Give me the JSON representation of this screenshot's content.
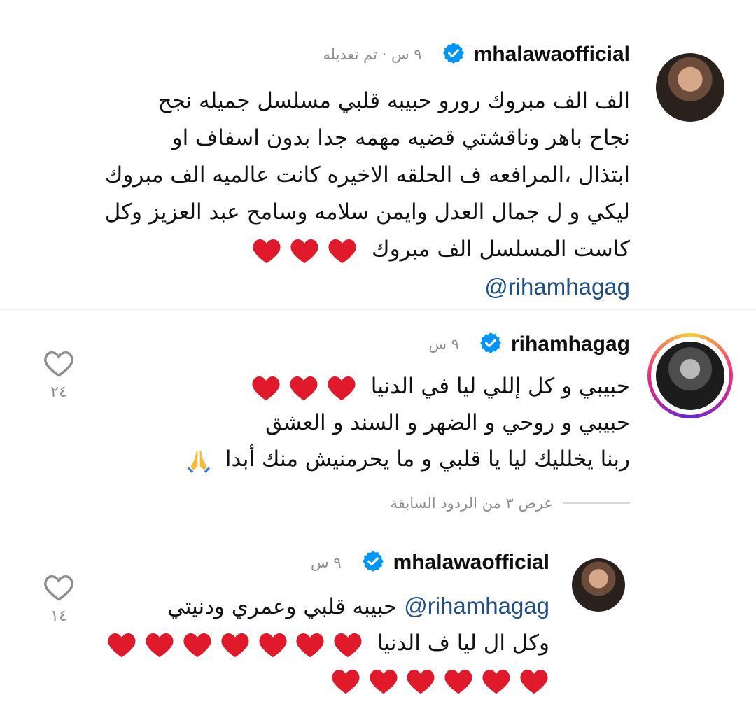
{
  "comments": [
    {
      "username": "mhalawaofficial",
      "meta": "٩ س · تم تعديله",
      "lines": [
        "الف الف مبروك رورو حبيبه قلبي مسلسل جميله نجح",
        "نجاح باهر وناقشتي قضيه مهمه جدا بدون اسفاف او",
        "ابتذال ،المرافعه ف الحلقه الاخيره كانت عالميه  الف مبروك",
        "ليكي و ل جمال العدل وايمن سلامه وسامح عبد العزيز وكل",
        "كاست المسلسل الف مبروك"
      ],
      "mention": "@rihamhagag"
    },
    {
      "username": "rihamhagag",
      "meta": "٩ س",
      "lines": [
        "حبيبي و كل إللي ليا في الدنيا",
        "حبيبي و روحي و الضهر و السند و العشق",
        "ربنا يخلليك ليا يا قلبي و ما يحرمنيش منك أبدا"
      ],
      "likes": "٢٤",
      "view_replies": "عرض ٣ من الردود السابقة"
    },
    {
      "username": "mhalawaofficial",
      "meta": "٩ س",
      "mention": "@rihamhagag",
      "lines": [
        "حبيبه قلبي وعمري ودنيتي",
        "وكل ال ليا ف الدنيا"
      ],
      "likes": "١٤"
    }
  ],
  "icons": {
    "verified": "verified-badge-icon",
    "heart_emoji": "red-heart-icon",
    "prayer_emoji": "folded-hands-icon",
    "like": "heart-outline-icon"
  },
  "colors": {
    "verified": "#0095f6",
    "mention": "#1f4f86",
    "heart": "#e0192b",
    "meta": "#8e8e8e"
  }
}
